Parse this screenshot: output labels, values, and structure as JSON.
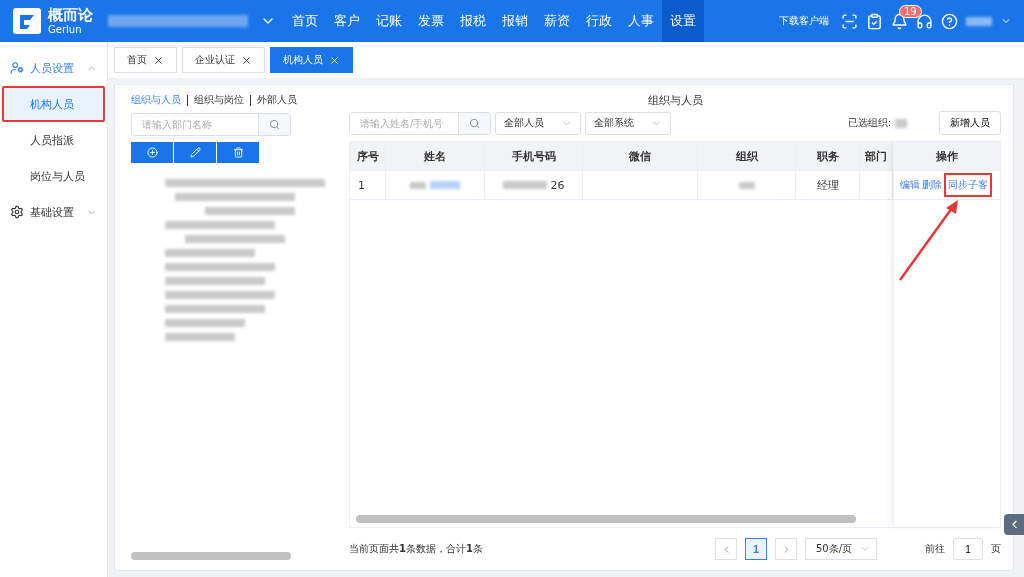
{
  "header": {
    "brand": "概而论",
    "brand_sub": "Gerlun",
    "nav": [
      {
        "label": "首页",
        "selected": false
      },
      {
        "label": "客户",
        "selected": false
      },
      {
        "label": "记账",
        "selected": false
      },
      {
        "label": "发票",
        "selected": false
      },
      {
        "label": "报税",
        "selected": false
      },
      {
        "label": "报销",
        "selected": false
      },
      {
        "label": "薪资",
        "selected": false
      },
      {
        "label": "行政",
        "selected": false
      },
      {
        "label": "人事",
        "selected": false
      },
      {
        "label": "设置",
        "selected": true
      }
    ],
    "download": "下载客户端",
    "badge": "19"
  },
  "sidebar": {
    "groups": [
      {
        "label": "人员设置",
        "expanded": true,
        "items": [
          {
            "label": "机构人员",
            "selected": true
          },
          {
            "label": "人员指派",
            "selected": false
          },
          {
            "label": "岗位与人员",
            "selected": false
          }
        ]
      },
      {
        "label": "基础设置",
        "expanded": false
      }
    ]
  },
  "tabs": [
    {
      "label": "首页",
      "selected": false
    },
    {
      "label": "企业认证",
      "selected": false
    },
    {
      "label": "机构人员",
      "selected": true
    }
  ],
  "left_panel": {
    "views": [
      {
        "label": "组织与人员",
        "selected": true
      },
      {
        "label": "组织与岗位",
        "selected": false
      },
      {
        "label": "外部人员",
        "selected": false
      }
    ],
    "search": {
      "placeholder": "请输入部门名称"
    }
  },
  "main": {
    "title": "组织与人员",
    "search": {
      "placeholder": "请输入姓名/手机号"
    },
    "filters": [
      "全部人员",
      "全部系统"
    ],
    "selected_org_label": "已选组织:",
    "add_button": "新增人员",
    "table": {
      "columns": [
        "序号",
        "姓名",
        "手机号码",
        "微信",
        "组织",
        "职务",
        "部门"
      ],
      "action_column": "操作",
      "rows": [
        {
          "index": "1",
          "phone_tail": "26",
          "position": "经理",
          "actions": [
            "编辑",
            "删除",
            "同步子客"
          ]
        }
      ]
    },
    "pagination": {
      "summary": "当前页面共**1**条数据，合计**1**条",
      "pages": [
        {
          "label": "1",
          "selected": true
        }
      ],
      "page_size": "50条/页",
      "goto_label": "前往",
      "goto_value": "1",
      "goto_unit": "页"
    }
  }
}
